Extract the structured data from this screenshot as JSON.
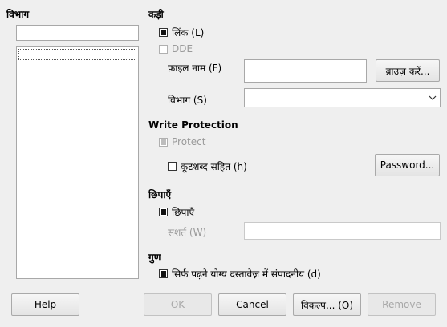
{
  "left": {
    "heading": "विभाग",
    "search_value": "",
    "list_items": [
      ""
    ]
  },
  "link": {
    "heading": "कड़ी",
    "link_checkbox": "लिंक (L)",
    "link_checked": true,
    "dde_checkbox": "DDE",
    "dde_checked": false,
    "filename_label": "फ़ाइल नाम (F)",
    "filename_value": "",
    "browse_button": "ब्राउज़ करें...",
    "section_label": "विभाग (S)",
    "section_value": ""
  },
  "write_protection": {
    "heading": "Write Protection",
    "protect_checkbox": "Protect",
    "protect_checked": true,
    "password_checkbox": "कूटशब्द सहित (h)",
    "password_checked": false,
    "password_button": "Password..."
  },
  "hide": {
    "heading": "छिपाएँ",
    "hide_checkbox": "छिपाएँ",
    "hide_checked": true,
    "condition_label": "सशर्त (W)",
    "condition_value": ""
  },
  "properties": {
    "heading": "गुण",
    "readonly_checkbox": "सिर्फ पढ़ने योग्य दस्तावेज़ में संपादनीय (d)",
    "readonly_checked": true
  },
  "footer": {
    "help": "Help",
    "ok": "OK",
    "cancel": "Cancel",
    "options": "विकल्प... (O)",
    "remove": "Remove"
  }
}
